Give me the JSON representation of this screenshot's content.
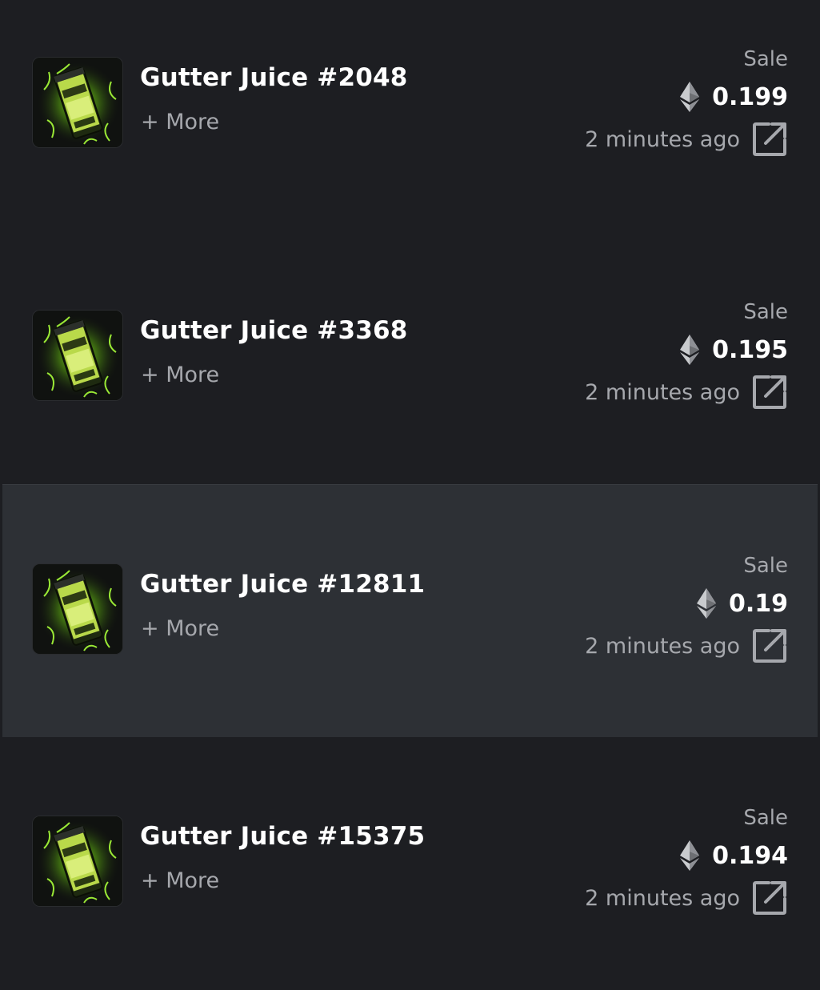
{
  "colors": {
    "background": "#1d1e22",
    "highlight_row": "#2d3035",
    "text_primary": "#ffffff",
    "text_secondary": "#a6a8ad",
    "thumb_glow": "#7fdc1e"
  },
  "sales": [
    {
      "title": "Gutter Juice #2048",
      "more_label": "+ More",
      "event_type": "Sale",
      "currency_icon": "ethereum-icon",
      "price": "0.199",
      "time": "2 minutes ago",
      "link_icon": "external-link-icon",
      "highlighted": false
    },
    {
      "title": "Gutter Juice #3368",
      "more_label": "+ More",
      "event_type": "Sale",
      "currency_icon": "ethereum-icon",
      "price": "0.195",
      "time": "2 minutes ago",
      "link_icon": "external-link-icon",
      "highlighted": false
    },
    {
      "title": "Gutter Juice #12811",
      "more_label": "+ More",
      "event_type": "Sale",
      "currency_icon": "ethereum-icon",
      "price": "0.19",
      "time": "2 minutes ago",
      "link_icon": "external-link-icon",
      "highlighted": true
    },
    {
      "title": "Gutter Juice #15375",
      "more_label": "+ More",
      "event_type": "Sale",
      "currency_icon": "ethereum-icon",
      "price": "0.194",
      "time": "2 minutes ago",
      "link_icon": "external-link-icon",
      "highlighted": false
    }
  ]
}
